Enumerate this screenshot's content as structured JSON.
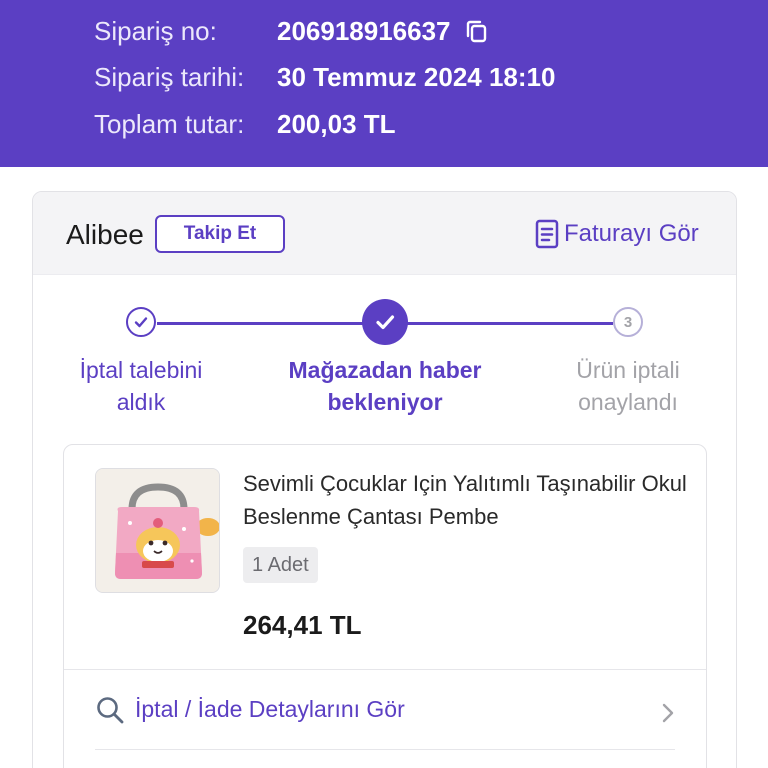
{
  "order": {
    "number_label": "Sipariş no:",
    "number_value": "206918916637",
    "date_label": "Sipariş tarihi:",
    "date_value": "30 Temmuz 2024 18:10",
    "total_label": "Toplam tutar:",
    "total_value": "200,03 TL"
  },
  "store": {
    "name": "Alibee",
    "follow_label": "Takip Et",
    "invoice_label": "Faturayı Gör"
  },
  "steps": [
    {
      "label_line1": "İptal talebini",
      "label_line2": "aldık",
      "state": "done"
    },
    {
      "label_line1": "Mağazadan haber",
      "label_line2": "bekleniyor",
      "state": "active"
    },
    {
      "label_line1": "Ürün iptali",
      "label_line2": "onaylandı",
      "state": "pending",
      "number": "3"
    }
  ],
  "product": {
    "title": "Sevimli Çocuklar Için Yalıtımlı Taşınabilir Okul Beslenme Çantası Pembe",
    "quantity": "1 Adet",
    "price": "264,41 TL"
  },
  "details_link": "İptal / İade Detaylarını Gör",
  "icons": {
    "copy": "copy-icon",
    "invoice": "document-icon",
    "search": "search-icon",
    "chevron": "chevron-right-icon",
    "check": "check-icon"
  },
  "colors": {
    "primary": "#5b3fc3",
    "header_bg": "#5b3fc3",
    "muted_text": "#a3a3a8"
  }
}
